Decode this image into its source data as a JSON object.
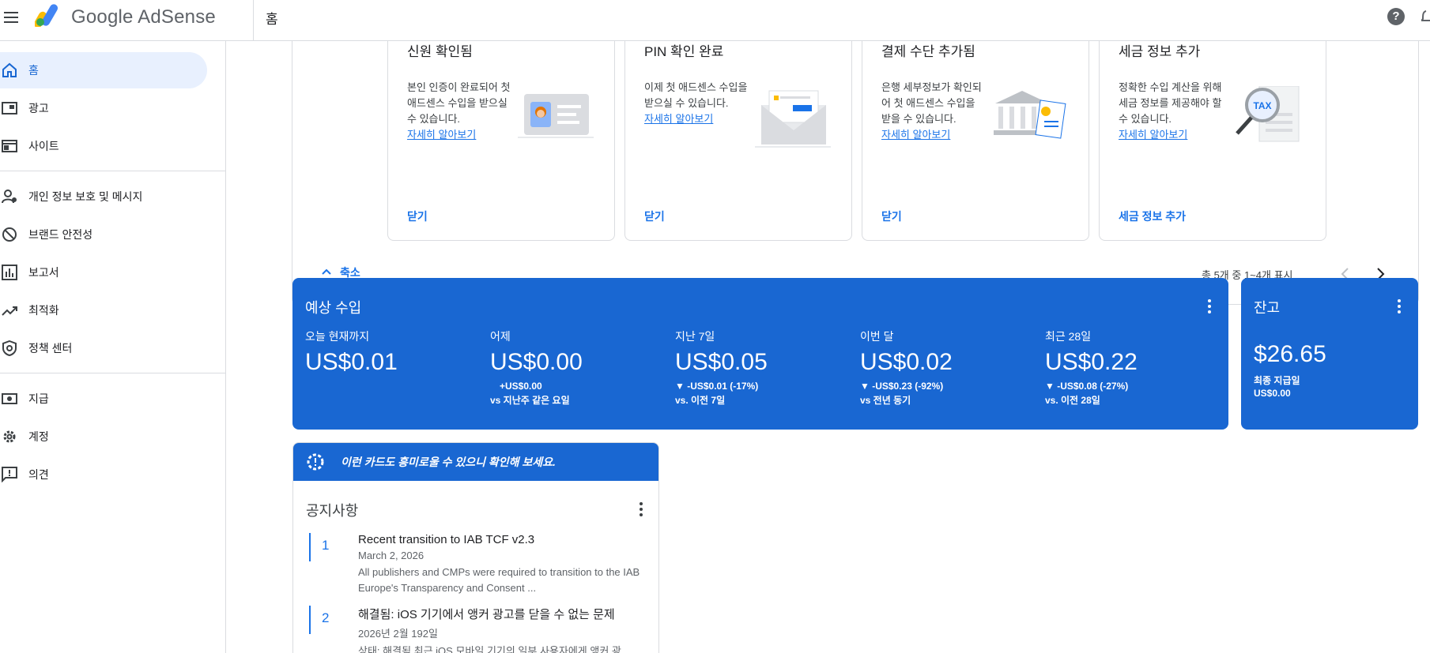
{
  "app": {
    "name": "Google AdSense",
    "breadcrumb": "홈"
  },
  "colors": {
    "accent": "#1967d2",
    "link": "#1a73e8"
  },
  "sidebar": {
    "items": [
      {
        "label": "홈",
        "icon": "home-icon",
        "active": true
      },
      {
        "label": "광고",
        "icon": "ads-icon"
      },
      {
        "label": "사이트",
        "icon": "sites-icon"
      },
      {
        "label": "개인 정보 보호 및 메시지",
        "icon": "privacy-icon"
      },
      {
        "label": "브랜드 안전성",
        "icon": "block-icon"
      },
      {
        "label": "보고서",
        "icon": "reports-icon"
      },
      {
        "label": "최적화",
        "icon": "trending-icon"
      },
      {
        "label": "정책 센터",
        "icon": "policy-icon"
      },
      {
        "label": "지급",
        "icon": "payments-icon"
      },
      {
        "label": "계정",
        "icon": "gear-icon"
      },
      {
        "label": "의견",
        "icon": "feedback-icon"
      }
    ]
  },
  "promos": {
    "cards": [
      {
        "title": "신원 확인됨",
        "desc": "본인 인증이 완료되어 첫 애드센스 수입을 받으실 수 있습니다.",
        "link": "자세히 알아보기",
        "action": "닫기"
      },
      {
        "title": "PIN 확인 완료",
        "desc": "이제 첫 애드센스 수입을 받으실 수 있습니다.",
        "link": "자세히 알아보기",
        "action": "닫기"
      },
      {
        "title": "결제 수단 추가됨",
        "desc": "은행 세부정보가 확인되어 첫 애드센스 수입을 받을 수 있습니다.",
        "link": "자세히 알아보기",
        "action": "닫기"
      },
      {
        "title": "세금 정보 추가",
        "desc": "정확한 수입 계산을 위해 세금 정보를 제공해야 할 수 있습니다.",
        "link": "자세히 알아보기",
        "action": "세금 정보 추가"
      }
    ],
    "collapse_label": "축소",
    "pager_text": "총 5개 중 1~4개 표시",
    "tax_label": "TAX"
  },
  "earnings": {
    "title": "예상 수입",
    "metrics": [
      {
        "label": "오늘 현재까지",
        "value": "US$0.01",
        "delta": "",
        "vs": ""
      },
      {
        "label": "어제",
        "value": "US$0.00",
        "delta": "+US$0.00",
        "vs": "vs 지난주 같은 요일"
      },
      {
        "label": "지난 7일",
        "value": "US$0.05",
        "delta": "▼ -US$0.01 (-17%)",
        "vs": "vs. 이전 7일"
      },
      {
        "label": "이번 달",
        "value": "US$0.02",
        "delta": "▼ -US$0.23 (-92%)",
        "vs": "vs 전년 동기"
      },
      {
        "label": "최근 28일",
        "value": "US$0.22",
        "delta": "▼ -US$0.08 (-27%)",
        "vs": "vs. 이전 28일"
      }
    ]
  },
  "balance": {
    "title": "잔고",
    "value": "$26.65",
    "last_payment_label": "최종 지급일",
    "last_payment_value": "US$0.00"
  },
  "notice": {
    "banner": "이런 카드도 흥미로울 수 있으니 확인해 보세요.",
    "title": "공지사항",
    "items": [
      {
        "num": "1",
        "title": "Recent transition to IAB TCF v2.3",
        "date": "March 2, 2026",
        "desc": "All publishers and CMPs were required to transition to the IAB Europe's Transparency and Consent ..."
      },
      {
        "num": "2",
        "title": "해결됨: iOS 기기에서 앵커 광고를 닫을 수 없는 문제",
        "date": "2026년 2월 192일",
        "desc": "상태: 해결됨 최근 iOS 모바일 기기의 일부 사용자에게 앵커 광"
      }
    ]
  }
}
